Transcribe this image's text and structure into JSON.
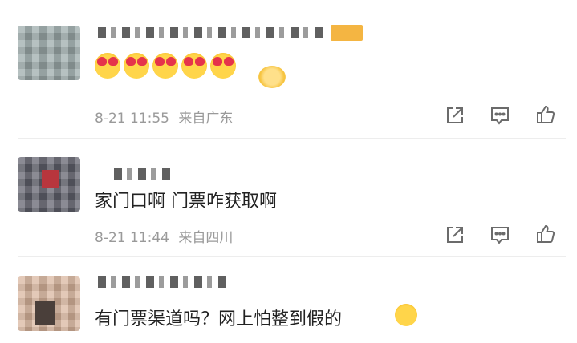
{
  "comments": [
    {
      "content": "",
      "timestamp": "8-21 11:55",
      "location": "来自广东",
      "emoji_count": 5,
      "icons": [
        "share-icon",
        "comment-icon",
        "like-icon"
      ]
    },
    {
      "content": "家门口啊 门票咋获取啊",
      "timestamp": "8-21 11:44",
      "location": "来自四川",
      "icons": [
        "share-icon",
        "comment-icon",
        "like-icon"
      ]
    },
    {
      "content": "有门票渠道吗？网上怕整到假的",
      "trailing_emoji": "laughing-crying-emoji"
    }
  ],
  "colors": {
    "text": "#222222",
    "meta": "#9a9a9a",
    "icon": "#6b6b6b",
    "divider": "#ededed"
  }
}
